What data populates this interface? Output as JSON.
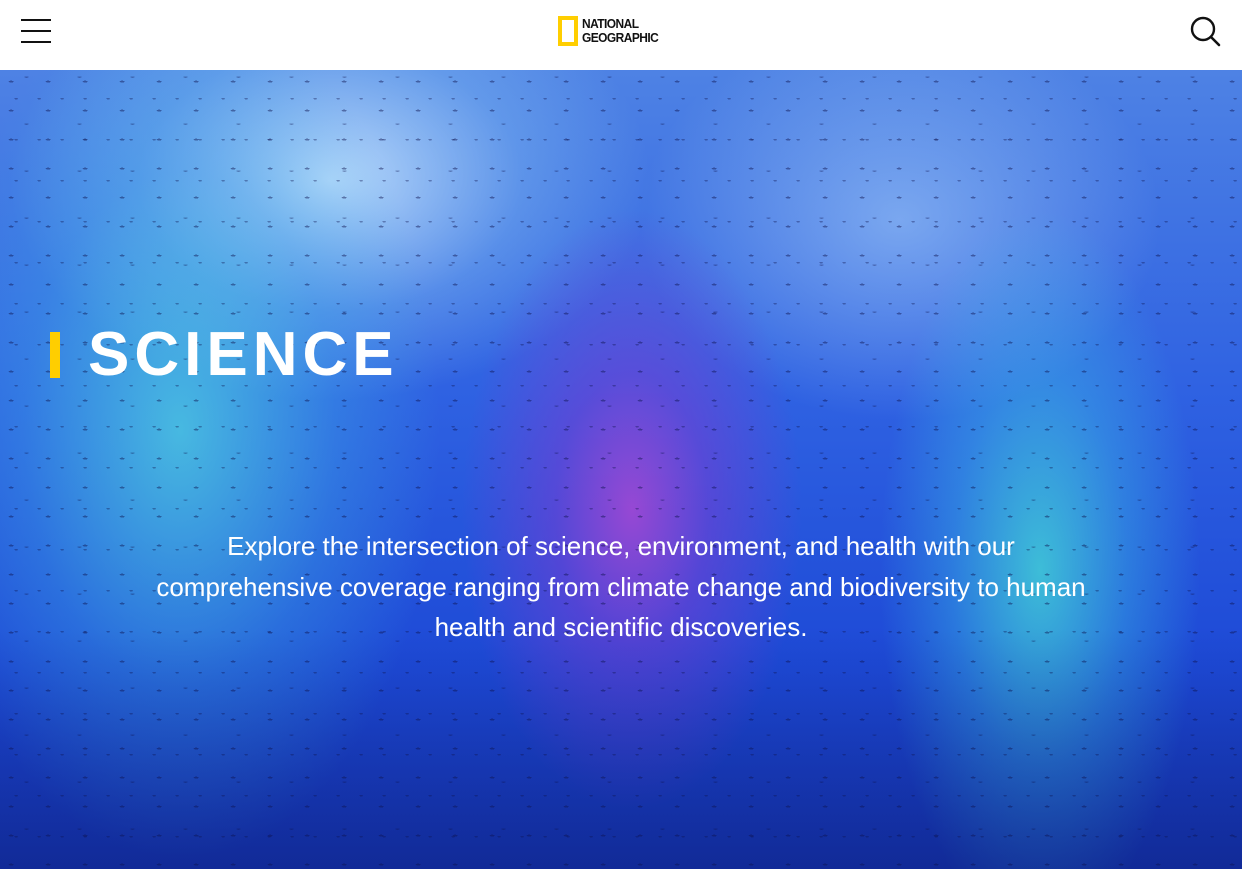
{
  "header": {
    "menu_icon": "hamburger-menu-icon",
    "logo": {
      "line1": "NATIONAL",
      "line2": "GEOGRAPHIC",
      "frame_color": "#ffce00"
    },
    "search_icon": "search-icon"
  },
  "hero": {
    "title": "SCIENCE",
    "accent_color": "#ffce00",
    "description": "Explore the intersection of science, environment, and health with our comprehensive coverage ranging from climate change and biodiversity to human health and scientific discoveries."
  }
}
